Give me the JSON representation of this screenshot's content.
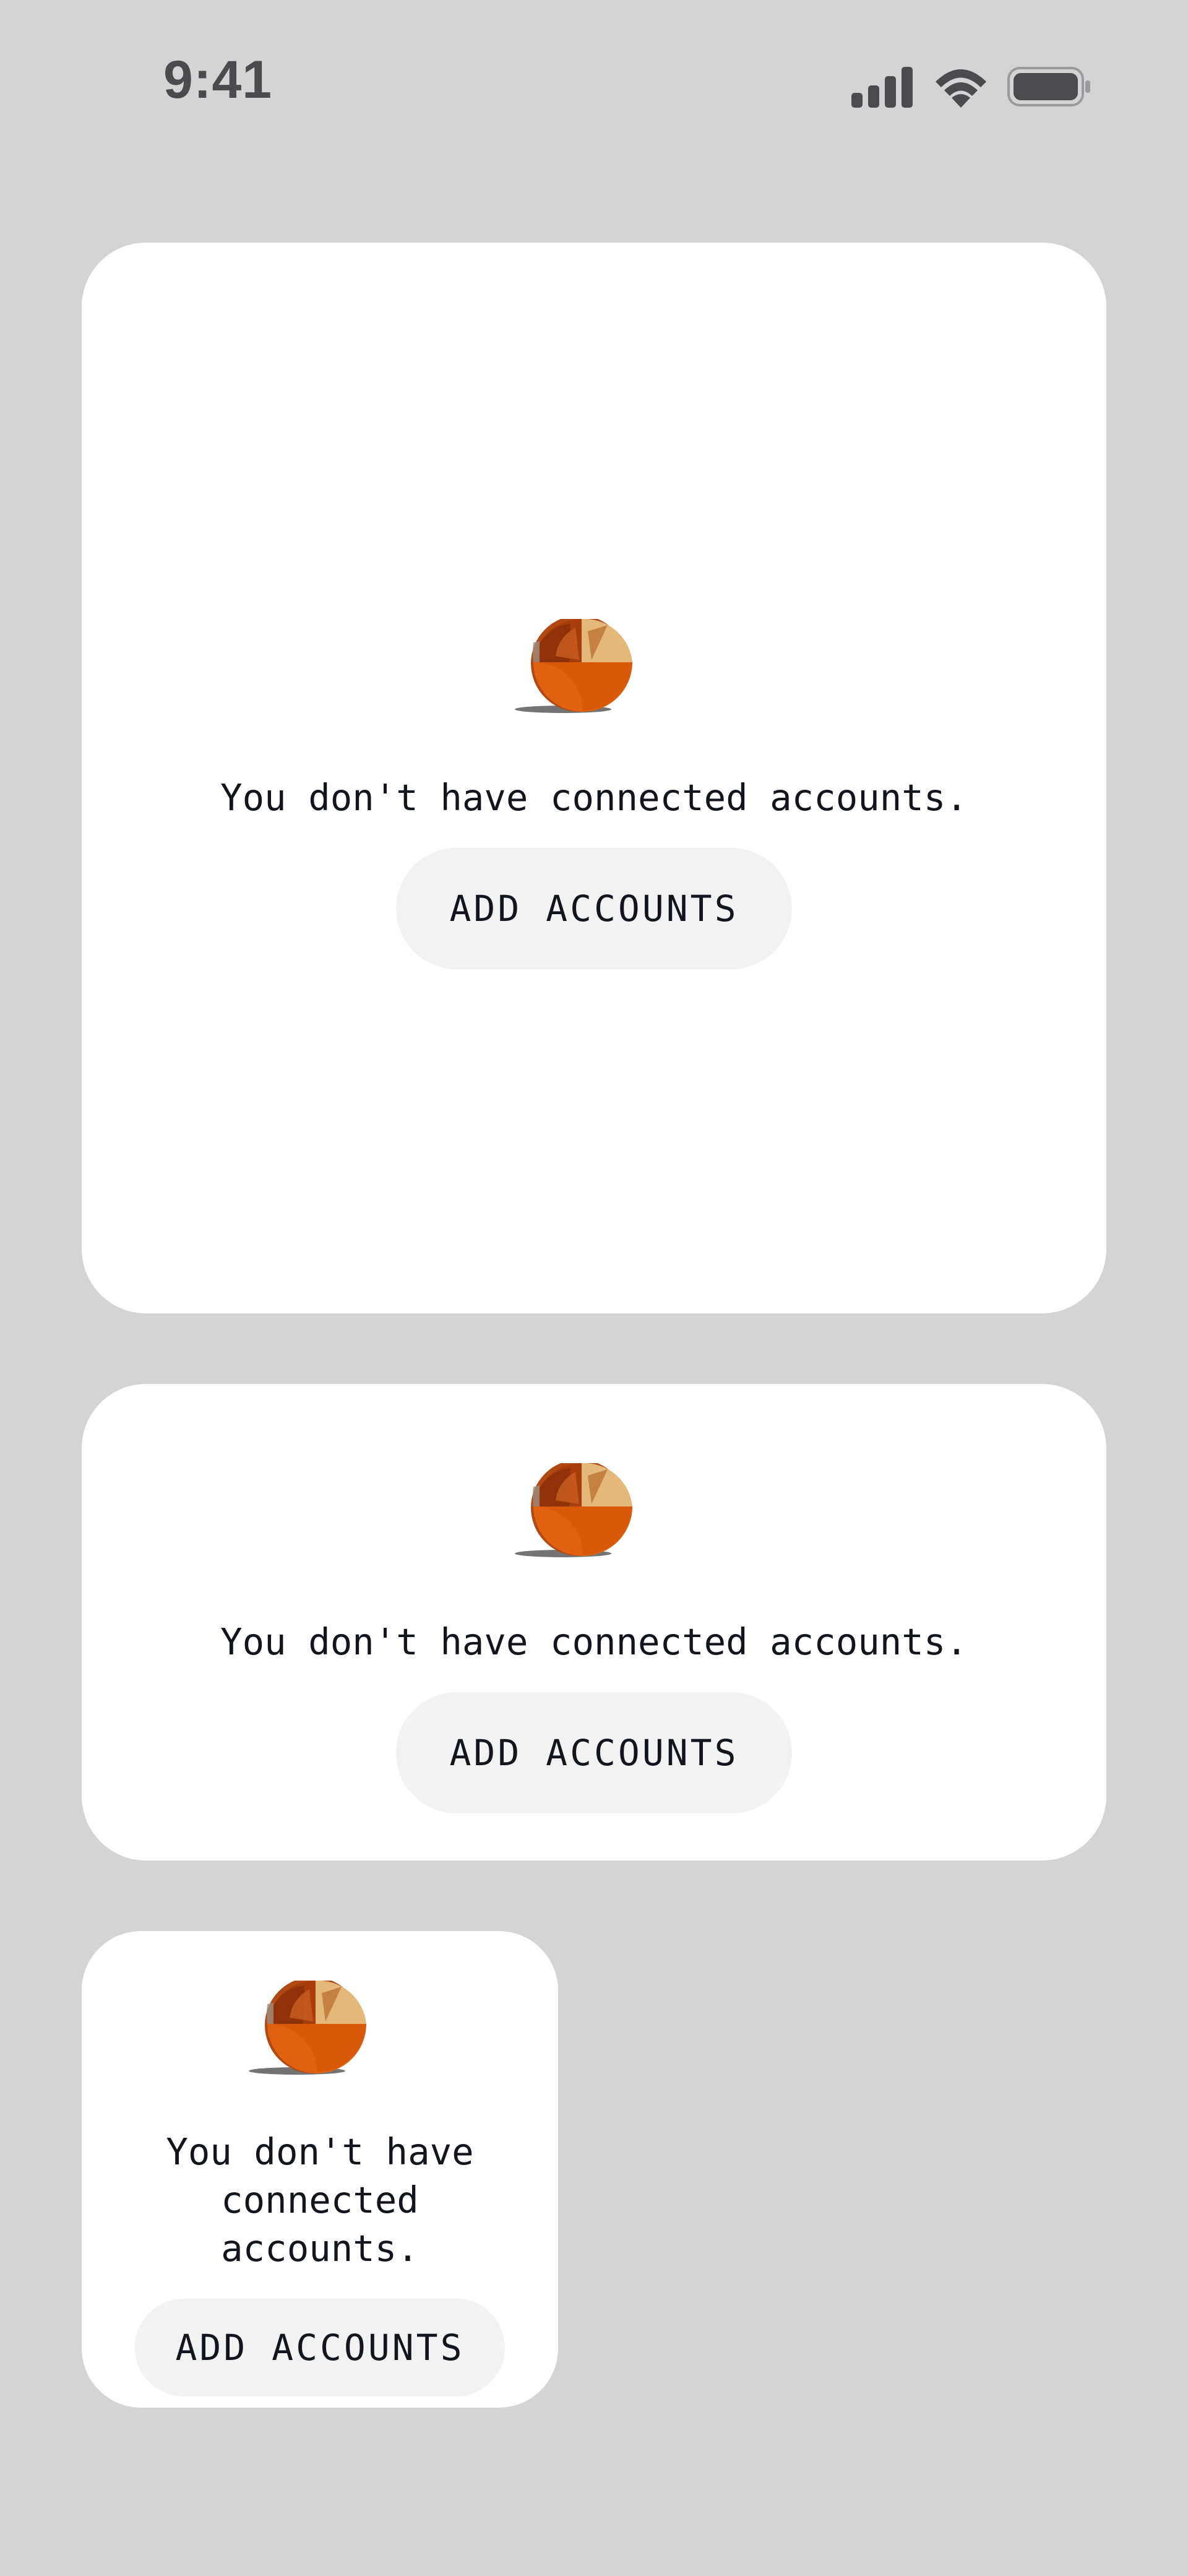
{
  "status_bar": {
    "time": "9:41",
    "icons": [
      "signal-icon",
      "wifi-icon",
      "battery-icon"
    ]
  },
  "colors": {
    "background": "#d4d4d4",
    "card": "#ffffff",
    "button_bg": "#f2f2f3",
    "text": "#14141e",
    "coin_orange": "#e06210"
  },
  "widgets": {
    "large": {
      "icon": "coin-icon",
      "message": "You don't have connected accounts.",
      "button_label": "ADD ACCOUNTS"
    },
    "medium": {
      "icon": "coin-icon",
      "message": "You don't have connected accounts.",
      "button_label": "ADD ACCOUNTS"
    },
    "small": {
      "icon": "coin-icon",
      "message": "You don't have\nconnected\naccounts.",
      "button_label": "ADD ACCOUNTS"
    }
  }
}
